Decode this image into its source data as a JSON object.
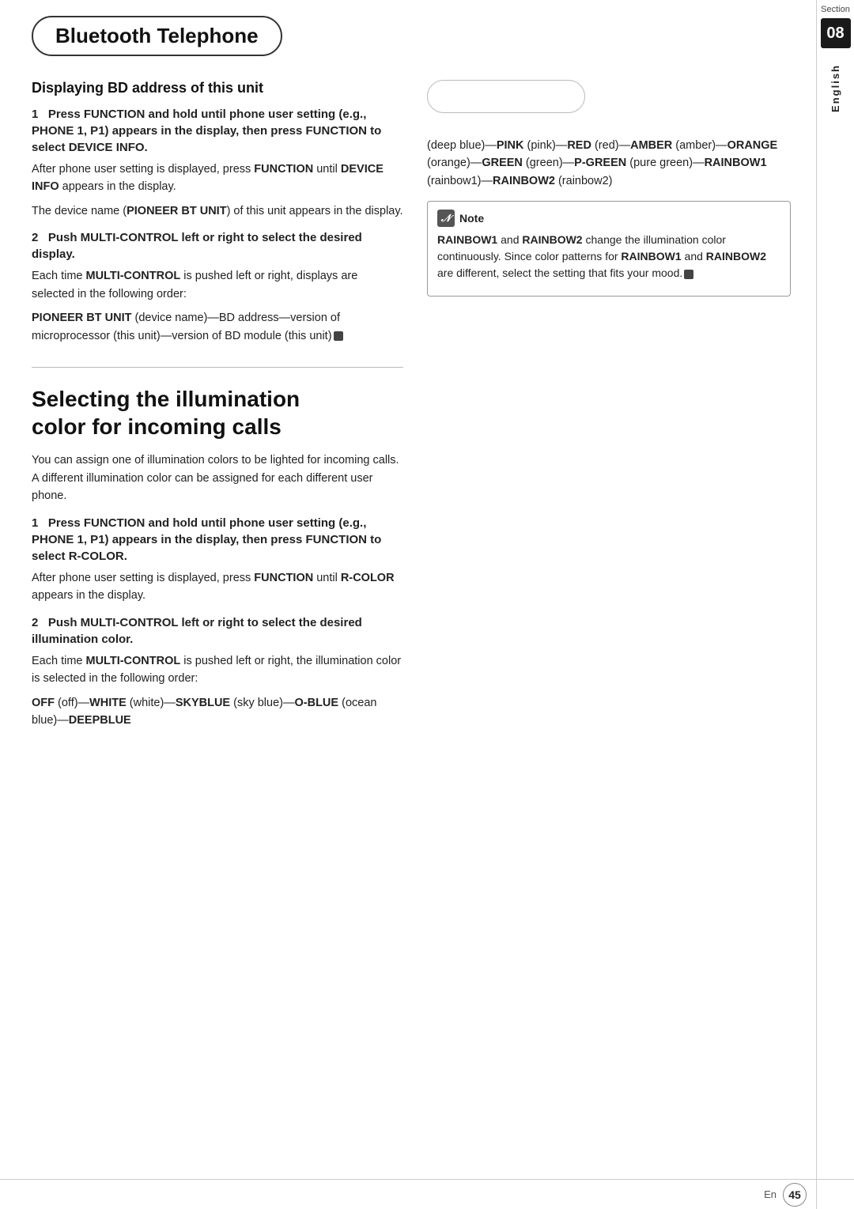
{
  "sidebar": {
    "section_label": "Section",
    "section_number": "08",
    "language": "English"
  },
  "title": "Bluetooth Telephone",
  "left_column": {
    "section1": {
      "heading": "Displaying BD address of this unit",
      "step1": {
        "heading": "1   Press FUNCTION and hold until phone user setting (e.g., PHONE 1, P1) appears in the display, then press FUNCTION to select DEVICE INFO.",
        "body": "After phone user setting is displayed, press FUNCTION until DEVICE INFO appears in the display.",
        "body2": "The device name (PIONEER BT UNIT) of this unit appears in the display."
      },
      "step2": {
        "heading": "2   Push MULTI-CONTROL left or right to select the desired display.",
        "body": "Each time MULTI-CONTROL is pushed left or right, displays are selected in the following order:",
        "body2": "PIONEER BT UNIT (device name)—BD address—version of microprocessor (this unit)—version of BD module (this unit)"
      }
    },
    "section2": {
      "heading": "Selecting the illumination color for incoming calls",
      "intro": "You can assign one of illumination colors to be lighted for incoming calls. A different illumination color can be assigned for each different user phone.",
      "step1": {
        "heading": "1   Press FUNCTION and hold until phone user setting (e.g., PHONE 1, P1) appears in the display, then press FUNCTION to select R-COLOR.",
        "body": "After phone user setting is displayed, press FUNCTION until R-COLOR appears in the display."
      },
      "step2": {
        "heading": "2   Push MULTI-CONTROL left or right to select the desired illumination color.",
        "body": "Each time MULTI-CONTROL is pushed left or right, the illumination color is selected in the following order:",
        "body2": "OFF (off)—WHITE (white)—SKYBLUE (sky blue)—O-BLUE (ocean blue)—DEEPBLUE"
      }
    }
  },
  "right_column": {
    "colors_text": "(deep blue)—PINK (pink)—RED (red)—AMBER (amber)—ORANGE (orange)—GREEN (green)—P-GREEN (pure green)—RAINBOW1 (rainbow1)—RAINBOW2 (rainbow2)",
    "note": {
      "header": "Note",
      "body": "RAINBOW1 and RAINBOW2 change the illumination color continuously. Since color patterns for RAINBOW1 and RAINBOW2 are different, select the setting that fits your mood."
    }
  },
  "footer": {
    "en_label": "En",
    "page_number": "45"
  }
}
